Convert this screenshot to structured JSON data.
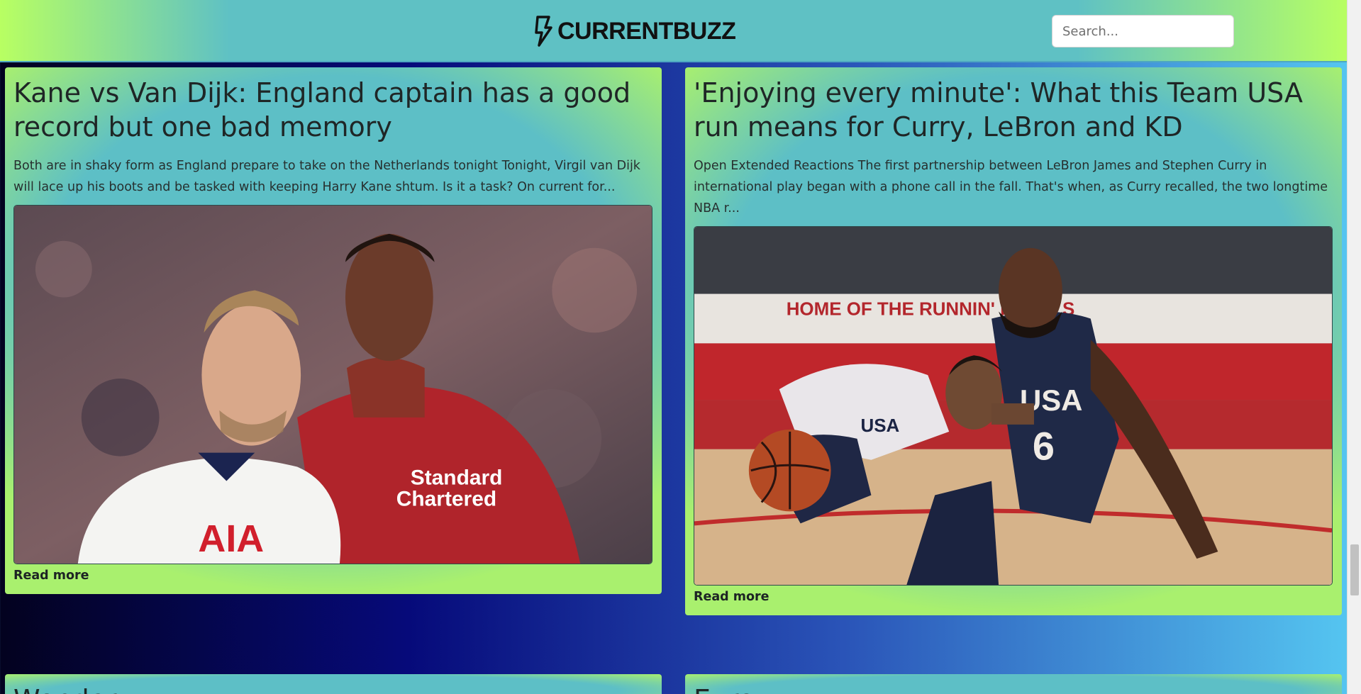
{
  "header": {
    "brand": "CURRENTBUZZ",
    "logo_icon": "lightning-bolt-icon",
    "search_placeholder": "Search..."
  },
  "articles": [
    {
      "title": "Kane vs Van Dijk: England captain has a good record but one bad memory",
      "summary": "Both are in shaky form as England prepare to take on the Netherlands tonight Tonight, Virgil van Dijk will lace up his boots and be tasked with keeping Harry Kane shtum. Is it a task? On current for...",
      "image_alt": "Harry Kane and Virgil van Dijk",
      "read_more": "Read more"
    },
    {
      "title": "'Enjoying every minute': What this Team USA run means for Curry, LeBron and KD",
      "summary": "Open Extended Reactions The first partnership between LeBron James and Stephen Curry in international play began with a phone call in the fall. That's when, as Curry recalled, the two longtime NBA r...",
      "image_alt": "Stephen Curry and LeBron James",
      "read_more": "Read more"
    },
    {
      "title": "Wonder…",
      "summary": "",
      "read_more": ""
    },
    {
      "title": "Euro…",
      "summary": "",
      "read_more": ""
    }
  ],
  "image_text": {
    "jersey_sponsor_1": "Standard",
    "jersey_sponsor_2": "Chartered",
    "jersey_sponsor_3": "AIA",
    "arena_banner": "HOME OF THE RUNNIN' REBELS",
    "usa_jersey": "USA",
    "jersey_number": "6"
  },
  "colors": {
    "header_gradient_edge": "#b8ff62",
    "header_gradient_mid": "#5fc1c4",
    "page_gradient_left": "#03021f",
    "page_gradient_right": "#56c8f2"
  }
}
